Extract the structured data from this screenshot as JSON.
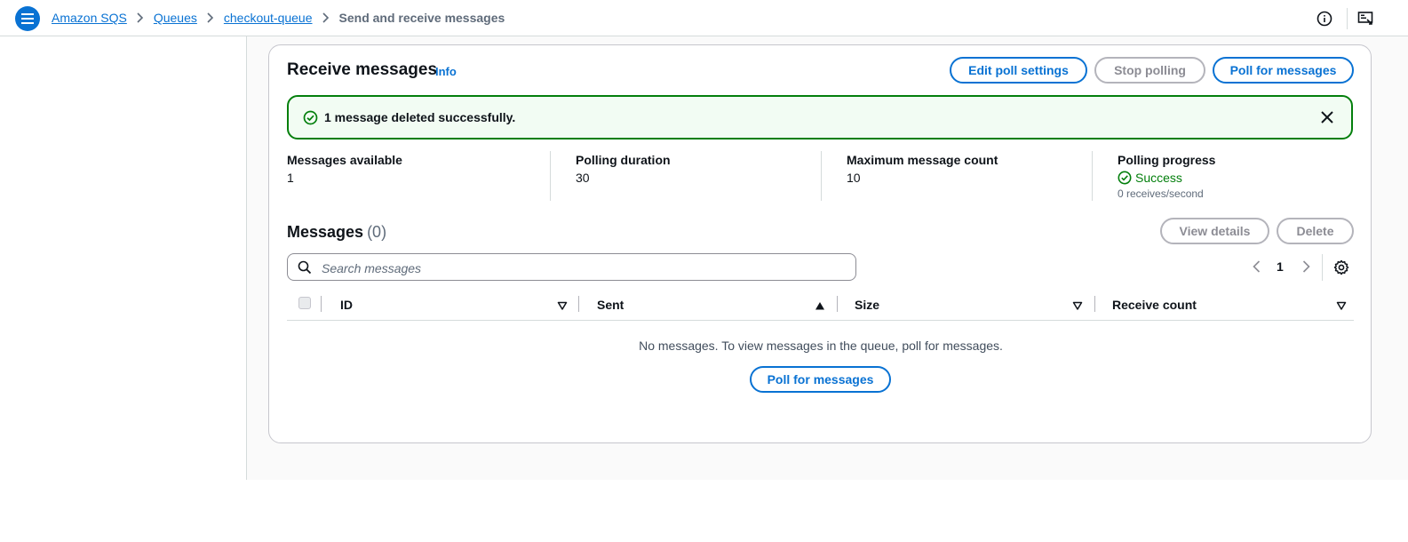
{
  "breadcrumb": {
    "items": [
      "Amazon SQS",
      "Queues",
      "checkout-queue"
    ],
    "current": "Send and receive messages"
  },
  "card": {
    "title": "Receive messages",
    "info": "Info",
    "edit_poll_label": "Edit poll settings",
    "stop_polling_label": "Stop polling",
    "poll_label": "Poll for messages"
  },
  "alert": {
    "text": "1 message deleted successfully."
  },
  "stats": {
    "available_label": "Messages available",
    "available_value": "1",
    "duration_label": "Polling duration",
    "duration_value": "30",
    "max_label": "Maximum message count",
    "max_value": "10",
    "progress_label": "Polling progress",
    "progress_status": "Success",
    "progress_rate": "0 receives/second"
  },
  "messages": {
    "title": "Messages",
    "count": "(0)",
    "view_details_label": "View details",
    "delete_label": "Delete",
    "search_placeholder": "Search messages",
    "page": "1",
    "columns": [
      "ID",
      "Sent",
      "Size",
      "Receive count"
    ],
    "empty_text": "No messages. To view messages in the queue, poll for messages.",
    "empty_poll_label": "Poll for messages"
  },
  "colors": {
    "accent": "#0972d3",
    "success": "#037f0c",
    "success_bg": "#f2fcf3"
  }
}
